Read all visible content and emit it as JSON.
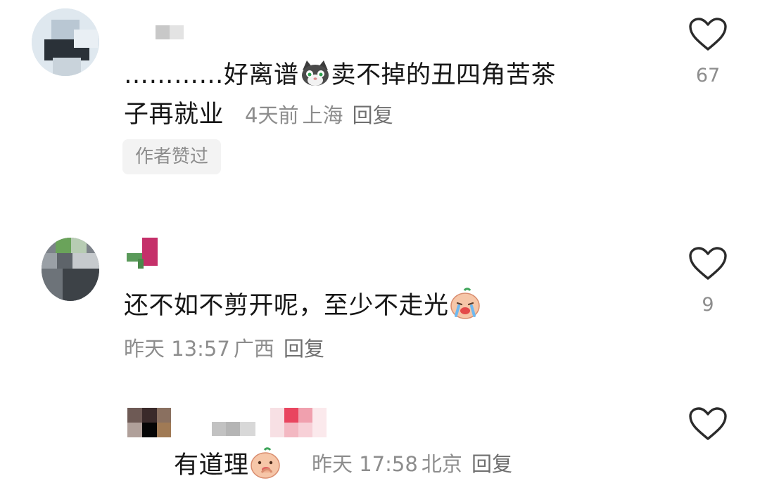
{
  "comments": [
    {
      "text_line1": "…………好离谱",
      "emoji_1": "cat-emoji",
      "text_line1b": "卖不掉的丑四角苦茶",
      "text_line2": "子再就业",
      "time": "4天前",
      "location": "上海",
      "reply_label": "回复",
      "badge": "作者赞过",
      "likes": "67"
    },
    {
      "text": "还不如不剪开呢，至少不走光",
      "emoji": "crying-face-emoji",
      "time": "昨天 13:57",
      "location": "广西",
      "reply_label": "回复",
      "likes": "9"
    },
    {
      "text": "有道理",
      "emoji": "thinking-face-emoji",
      "time": "昨天 17:58",
      "location": "北京",
      "reply_label": "回复"
    }
  ],
  "colors": {
    "text": "#161616",
    "meta": "#8d8d8d",
    "heart_stroke": "#2b2b2b",
    "badge_bg": "#f3f3f3"
  }
}
